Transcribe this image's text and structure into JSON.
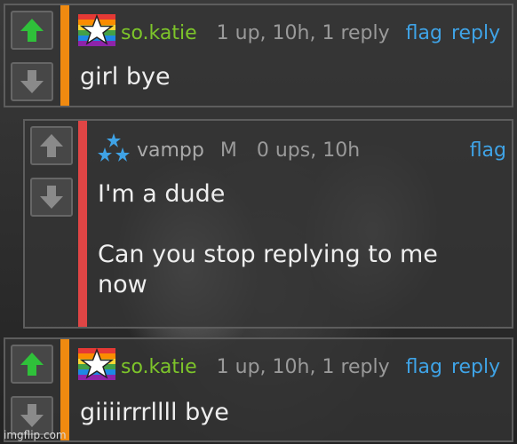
{
  "comments": [
    {
      "author": "so.katie",
      "meta": "1 up, 10h, 1 reply",
      "actions": [
        "flag",
        "reply"
      ],
      "body": "girl bye",
      "bar_color": "#f08a10"
    },
    {
      "author": "vampp",
      "mod_badge": "M",
      "meta": "0 ups, 10h",
      "actions": [
        "flag"
      ],
      "body": "I'm a dude\n\nCan you stop replying to me\nnow",
      "bar_color": "#e04545"
    },
    {
      "author": "so.katie",
      "meta": "1 up, 10h, 1 reply",
      "actions": [
        "flag",
        "reply"
      ],
      "body": "giiiirrrllll bye",
      "bar_color": "#f08a10"
    }
  ],
  "watermark": "imgflip.com",
  "icons": {
    "upvote": "arrow-up-icon",
    "downvote": "arrow-down-icon",
    "pride_star_badge": "rainbow-star-badge",
    "blue_stars_badge": "blue-stars-badge"
  },
  "colors": {
    "upvote_active": "#2fc13a",
    "vote_inactive": "#8a8a8a",
    "author": "#7dc52a",
    "link": "#3fa3e6"
  }
}
